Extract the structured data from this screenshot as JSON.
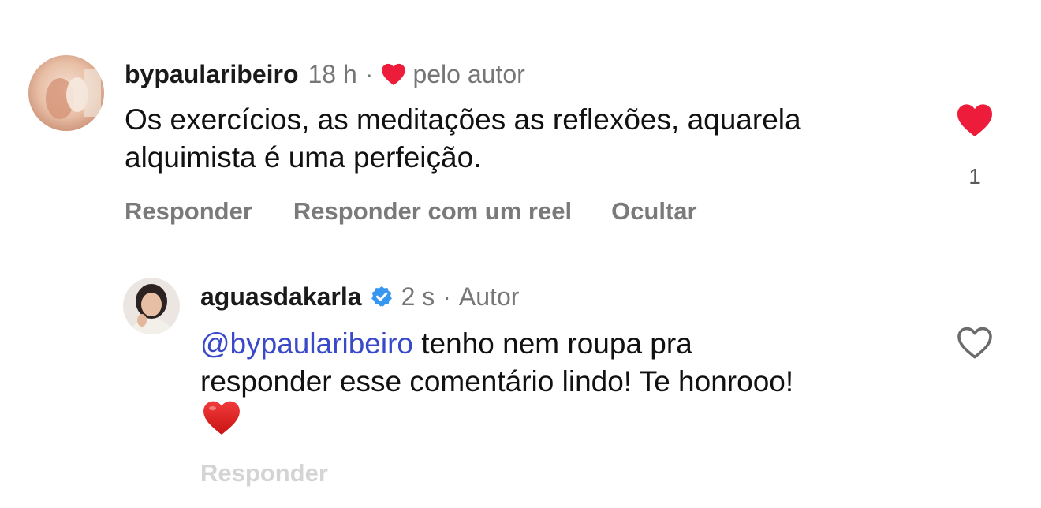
{
  "comment": {
    "username": "bypaularibeiro",
    "time": "18 h",
    "separator": "·",
    "liked_by_author_label": "pelo autor",
    "text_line1": "Os exercícios, as meditações as reflexões, aquarela",
    "text_line2": "alquimista é uma perfeição.",
    "like_count": "1",
    "actions": {
      "reply": "Responder",
      "reply_with_reel": "Responder com um reel",
      "hide": "Ocultar"
    }
  },
  "reply": {
    "username": "aguasdakarla",
    "time": "2 s",
    "separator": "·",
    "role_label": "Autor",
    "mention": "@bypaularibeiro",
    "text_line1": " tenho nem roupa pra",
    "text_line2": "responder esse comentário lindo! Te honrooo!",
    "emoji": "❤️",
    "actions": {
      "reply": "Responder"
    }
  },
  "colors": {
    "like_red": "#ed1c3a",
    "verified_blue": "#3797f0",
    "mention_blue": "#3949c9",
    "muted_gray": "#767676"
  },
  "icons": {
    "liked_heart": "heart-filled-icon",
    "unliked_heart": "heart-outline-icon",
    "verified": "verified-badge-icon"
  }
}
